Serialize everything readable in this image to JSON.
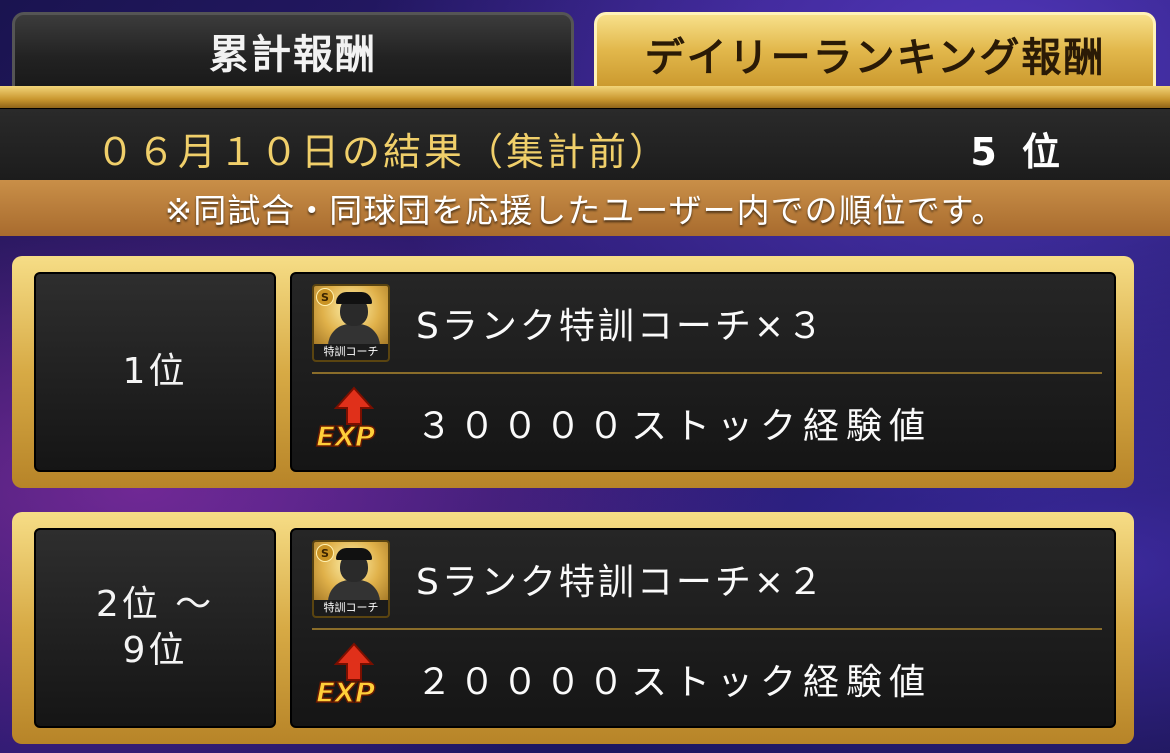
{
  "tabs": [
    {
      "label": "累計報酬",
      "active": false
    },
    {
      "label": "デイリーランキング報酬",
      "active": true
    }
  ],
  "result": {
    "date_label": "０６月１０日の結果（集計前）",
    "rank_label": "5 位"
  },
  "note": "※同試合・同球団を応援したユーザー内での順位です。",
  "rewards": [
    {
      "rank_lines": [
        "1位",
        ""
      ],
      "items": [
        {
          "icon": "coach-card-icon",
          "icon_badge": "S",
          "icon_caption": "特訓コーチ",
          "label": "Sランク特訓コーチ×３"
        },
        {
          "icon": "exp-icon",
          "icon_text": "EXP",
          "label": "３００００ストック経験値"
        }
      ]
    },
    {
      "rank_lines": [
        "2位 ～",
        "9位"
      ],
      "items": [
        {
          "icon": "coach-card-icon",
          "icon_badge": "S",
          "icon_caption": "特訓コーチ",
          "label": "Sランク特訓コーチ×２"
        },
        {
          "icon": "exp-icon",
          "icon_text": "EXP",
          "label": "２００００ストック経験値"
        }
      ]
    }
  ],
  "colors": {
    "gold": "#e2b84c",
    "date_text": "#f0cf6a",
    "note_bar": "#b87a38"
  }
}
